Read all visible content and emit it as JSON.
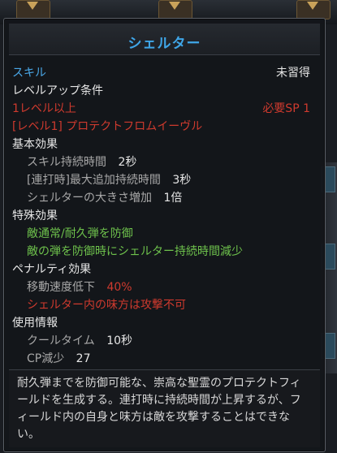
{
  "title": "シェルター",
  "skill_label": "スキル",
  "status": "未習得",
  "levelup": {
    "heading": "レベルアップ条件",
    "level_req": "1レベル以上",
    "sp_req": "必要SP 1",
    "prereq": "[レベル1] プロテクトフロムイーヴル"
  },
  "basic": {
    "heading": "基本効果",
    "rows": [
      {
        "label": "スキル持続時間",
        "value": "2秒"
      },
      {
        "label": "[連打時]最大追加持続時間",
        "value": "3秒"
      },
      {
        "label": "シェルターの大きさ増加",
        "value": "1倍"
      }
    ]
  },
  "special": {
    "heading": "特殊効果",
    "rows": [
      "敵通常/耐久弾を防御",
      "敵の弾を防御時にシェルター持続時間減少"
    ]
  },
  "penalty": {
    "heading": "ペナルティ効果",
    "speed_label": "移動速度低下",
    "speed_value": "40%",
    "note": "シェルター内の味方は攻撃不可"
  },
  "usage": {
    "heading": "使用情報",
    "cooldown_label": "クールタイム",
    "cooldown_value": "10秒",
    "cp_label": "CP減少",
    "cp_value": "27"
  },
  "description": "耐久弾までを防御可能な、崇高な聖霊のプロテクトフィールドを生成する。連打時に持続時間が上昇するが、フィールド内の自身と味方は敵を攻撃することはできない。",
  "colors": {
    "title": "#3fa6e8",
    "requirement": "#cf3a2e",
    "effect": "#6ec24c"
  }
}
